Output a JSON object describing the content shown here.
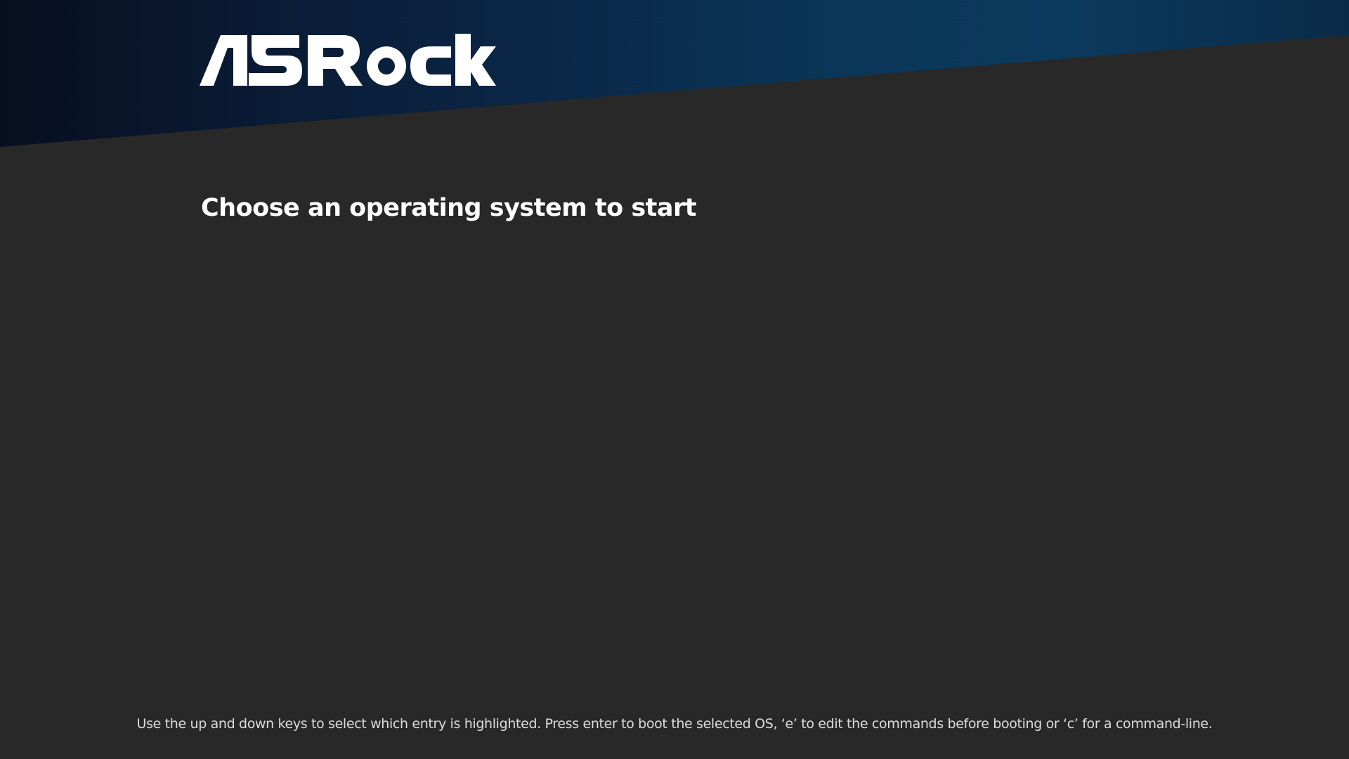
{
  "brand": {
    "logo_text": "ASRock",
    "banner_colors": [
      "#080f20",
      "#0b3a5e"
    ],
    "background_color": "#282828"
  },
  "title": "Choose an operating system to start",
  "menu": {
    "entries": []
  },
  "help_text": "Use the up and down keys to select which entry is highlighted. Press enter to boot the selected OS, ‘e’ to edit the commands before booting or ‘c’ for a command-line."
}
